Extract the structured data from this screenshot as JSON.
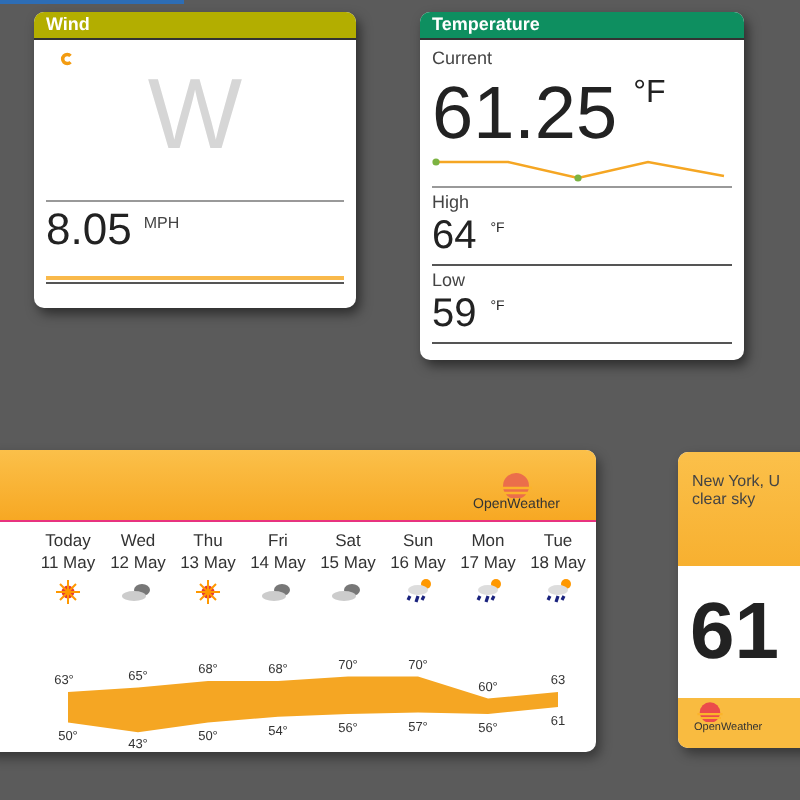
{
  "wind": {
    "title": "Wind",
    "direction": "W",
    "speed": "8.05",
    "unit": "MPH"
  },
  "temperature": {
    "title": "Temperature",
    "current_label": "Current",
    "current": "61.25",
    "unit": "°F",
    "high_label": "High",
    "high": "64",
    "high_unit": "°F",
    "low_label": "Low",
    "low": "59",
    "low_unit": "°F"
  },
  "forecast": {
    "brand": "OpenWeather",
    "days": [
      {
        "day": "Today",
        "date": "11 May",
        "kind": "sun",
        "high": "63°",
        "low": "50°"
      },
      {
        "day": "Wed",
        "date": "12 May",
        "kind": "cloud",
        "high": "65°",
        "low": "43°"
      },
      {
        "day": "Thu",
        "date": "13 May",
        "kind": "sun",
        "high": "68°",
        "low": "50°"
      },
      {
        "day": "Fri",
        "date": "14 May",
        "kind": "cloud",
        "high": "68°",
        "low": "54°"
      },
      {
        "day": "Sat",
        "date": "15 May",
        "kind": "cloud",
        "high": "70°",
        "low": "56°"
      },
      {
        "day": "Sun",
        "date": "16 May",
        "kind": "rain",
        "high": "70°",
        "low": "57°"
      },
      {
        "day": "Mon",
        "date": "17 May",
        "kind": "rain",
        "high": "60°",
        "low": "56°"
      },
      {
        "day": "Tue",
        "date": "18 May",
        "kind": "rain",
        "high": "63",
        "low": "61"
      }
    ]
  },
  "current": {
    "location": "New York, U",
    "description": "clear sky",
    "temperature": "61",
    "brand": "OpenWeather"
  }
}
